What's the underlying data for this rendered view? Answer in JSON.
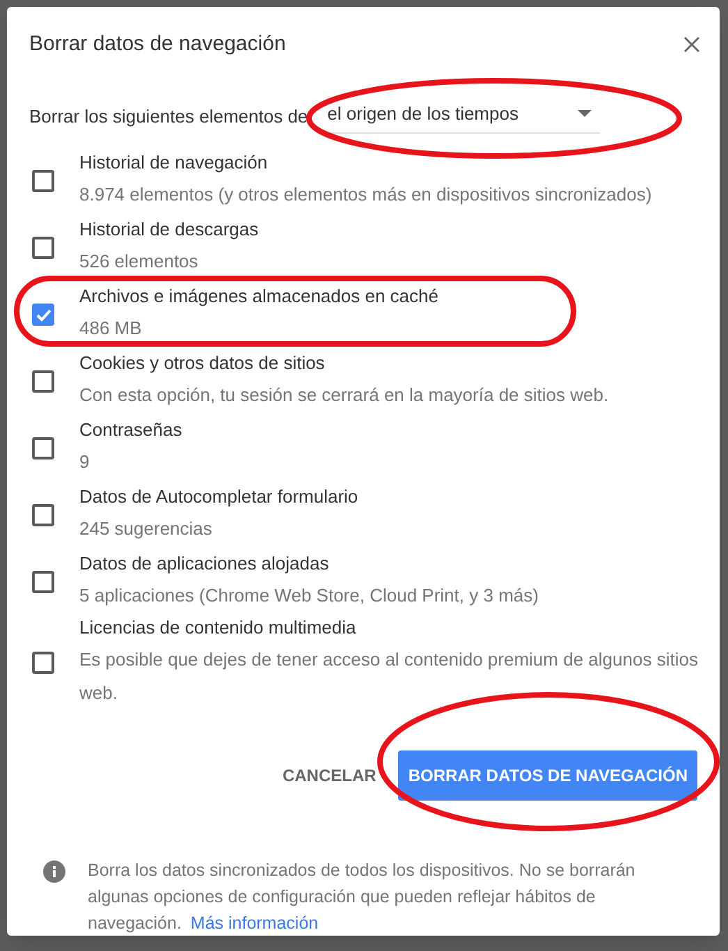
{
  "dialog": {
    "title": "Borrar datos de navegación",
    "range_label": "Borrar los siguientes elementos de",
    "range_value": "el origen de los tiempos",
    "items": [
      {
        "title": "Historial de navegación",
        "detail": "8.974 elementos (y otros elementos más en dispositivos sincronizados)",
        "checked": false
      },
      {
        "title": "Historial de descargas",
        "detail": "526 elementos",
        "checked": false
      },
      {
        "title": "Archivos e imágenes almacenados en caché",
        "detail": "486 MB",
        "checked": true
      },
      {
        "title": "Cookies y otros datos de sitios",
        "detail": "Con esta opción, tu sesión se cerrará en la mayoría de sitios web.",
        "checked": false
      },
      {
        "title": "Contraseñas",
        "detail": "9",
        "checked": false
      },
      {
        "title": "Datos de Autocompletar formulario",
        "detail": "245 sugerencias",
        "checked": false
      },
      {
        "title": "Datos de aplicaciones alojadas",
        "detail": "5 aplicaciones (Chrome Web Store, Cloud Print, y 3 más)",
        "checked": false
      },
      {
        "title": "Licencias de contenido multimedia",
        "detail": "Es posible que dejes de tener acceso al contenido premium de algunos sitios web.",
        "checked": false
      }
    ],
    "buttons": {
      "cancel": "CANCELAR",
      "confirm": "BORRAR DATOS DE NAVEGACIÓN"
    },
    "footer": {
      "text": "Borra los datos sincronizados de todos los dispositivos. No se borrarán algunas opciones de configuración que pueden reflejar hábitos de navegación.",
      "link": "Más información"
    }
  }
}
